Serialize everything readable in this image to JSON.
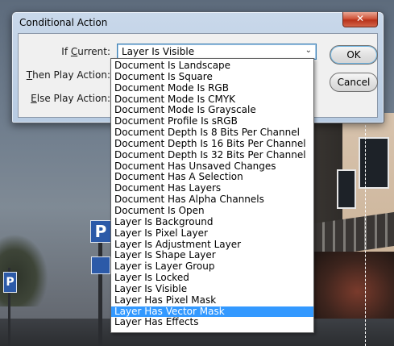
{
  "dialog": {
    "title": "Conditional Action",
    "close_glyph": "✕",
    "if_current_label_pre": "If ",
    "if_current_label_u": "C",
    "if_current_label_post": "urrent:",
    "then_label_u": "T",
    "then_label_post": "hen Play Action:",
    "else_label_u": "E",
    "else_label_post": "lse Play Action:",
    "selected_value": "Layer Is Visible",
    "ok_label": "OK",
    "cancel_label": "Cancel"
  },
  "dropdown": {
    "items": [
      "Document Is Landscape",
      "Document Is Square",
      "Document Mode Is RGB",
      "Document Mode Is CMYK",
      "Document Mode Is Grayscale",
      "Document Profile Is sRGB",
      "Document Depth Is 8 Bits Per Channel",
      "Document Depth Is 16 Bits Per Channel",
      "Document Depth Is 32 Bits Per Channel",
      "Document Has Unsaved Changes",
      "Document Has A Selection",
      "Document Has Layers",
      "Document Has Alpha Channels",
      "Document Is Open",
      "Layer Is Background",
      "Layer Is Pixel Layer",
      "Layer Is Adjustment Layer",
      "Layer Is Shape Layer",
      "Layer is Layer Group",
      "Layer Is Locked",
      "Layer Is Visible",
      "Layer Has Pixel Mask",
      "Layer Has Vector Mask",
      "Layer Has Effects"
    ],
    "highlighted": "Layer Has Vector Mask"
  },
  "background": {
    "parking_sign": "P"
  },
  "colors": {
    "highlight": "#3399ff",
    "focus_border": "#3c7fb1"
  }
}
